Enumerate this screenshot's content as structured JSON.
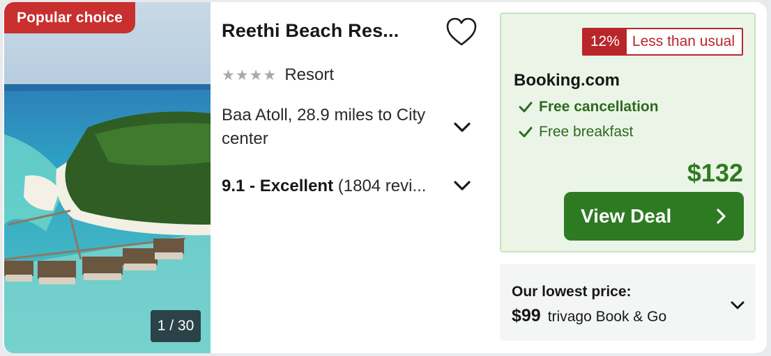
{
  "badge": {
    "popular": "Popular choice"
  },
  "photo": {
    "counter": "1 / 30"
  },
  "hotel": {
    "name": "Reethi Beach Res...",
    "stars": 4,
    "accommodation_type": "Resort",
    "location": "Baa Atoll, 28.9 miles to City center",
    "rating_score": "9.1 - Excellent",
    "rating_reviews": "(1804 revi..."
  },
  "deal": {
    "discount_percent": "12%",
    "discount_label": "Less than usual",
    "provider": "Booking.com",
    "perks": [
      "Free cancellation",
      "Free breakfast"
    ],
    "price": "$132",
    "cta_label": "View Deal"
  },
  "lowest_price": {
    "title": "Our lowest price:",
    "amount": "$99",
    "provider": "trivago Book & Go"
  },
  "icons": {
    "favorite": "heart-outline-icon",
    "expand": "chevron-down-icon",
    "perk": "checkmark-icon",
    "cta": "chevron-right-icon"
  },
  "colors": {
    "popular_badge": "#c8302f",
    "deal_green": "#2d7a22",
    "deal_bg": "#ebf5e7",
    "discount_red": "#b9262a",
    "star_grey": "#a9a9ad"
  }
}
